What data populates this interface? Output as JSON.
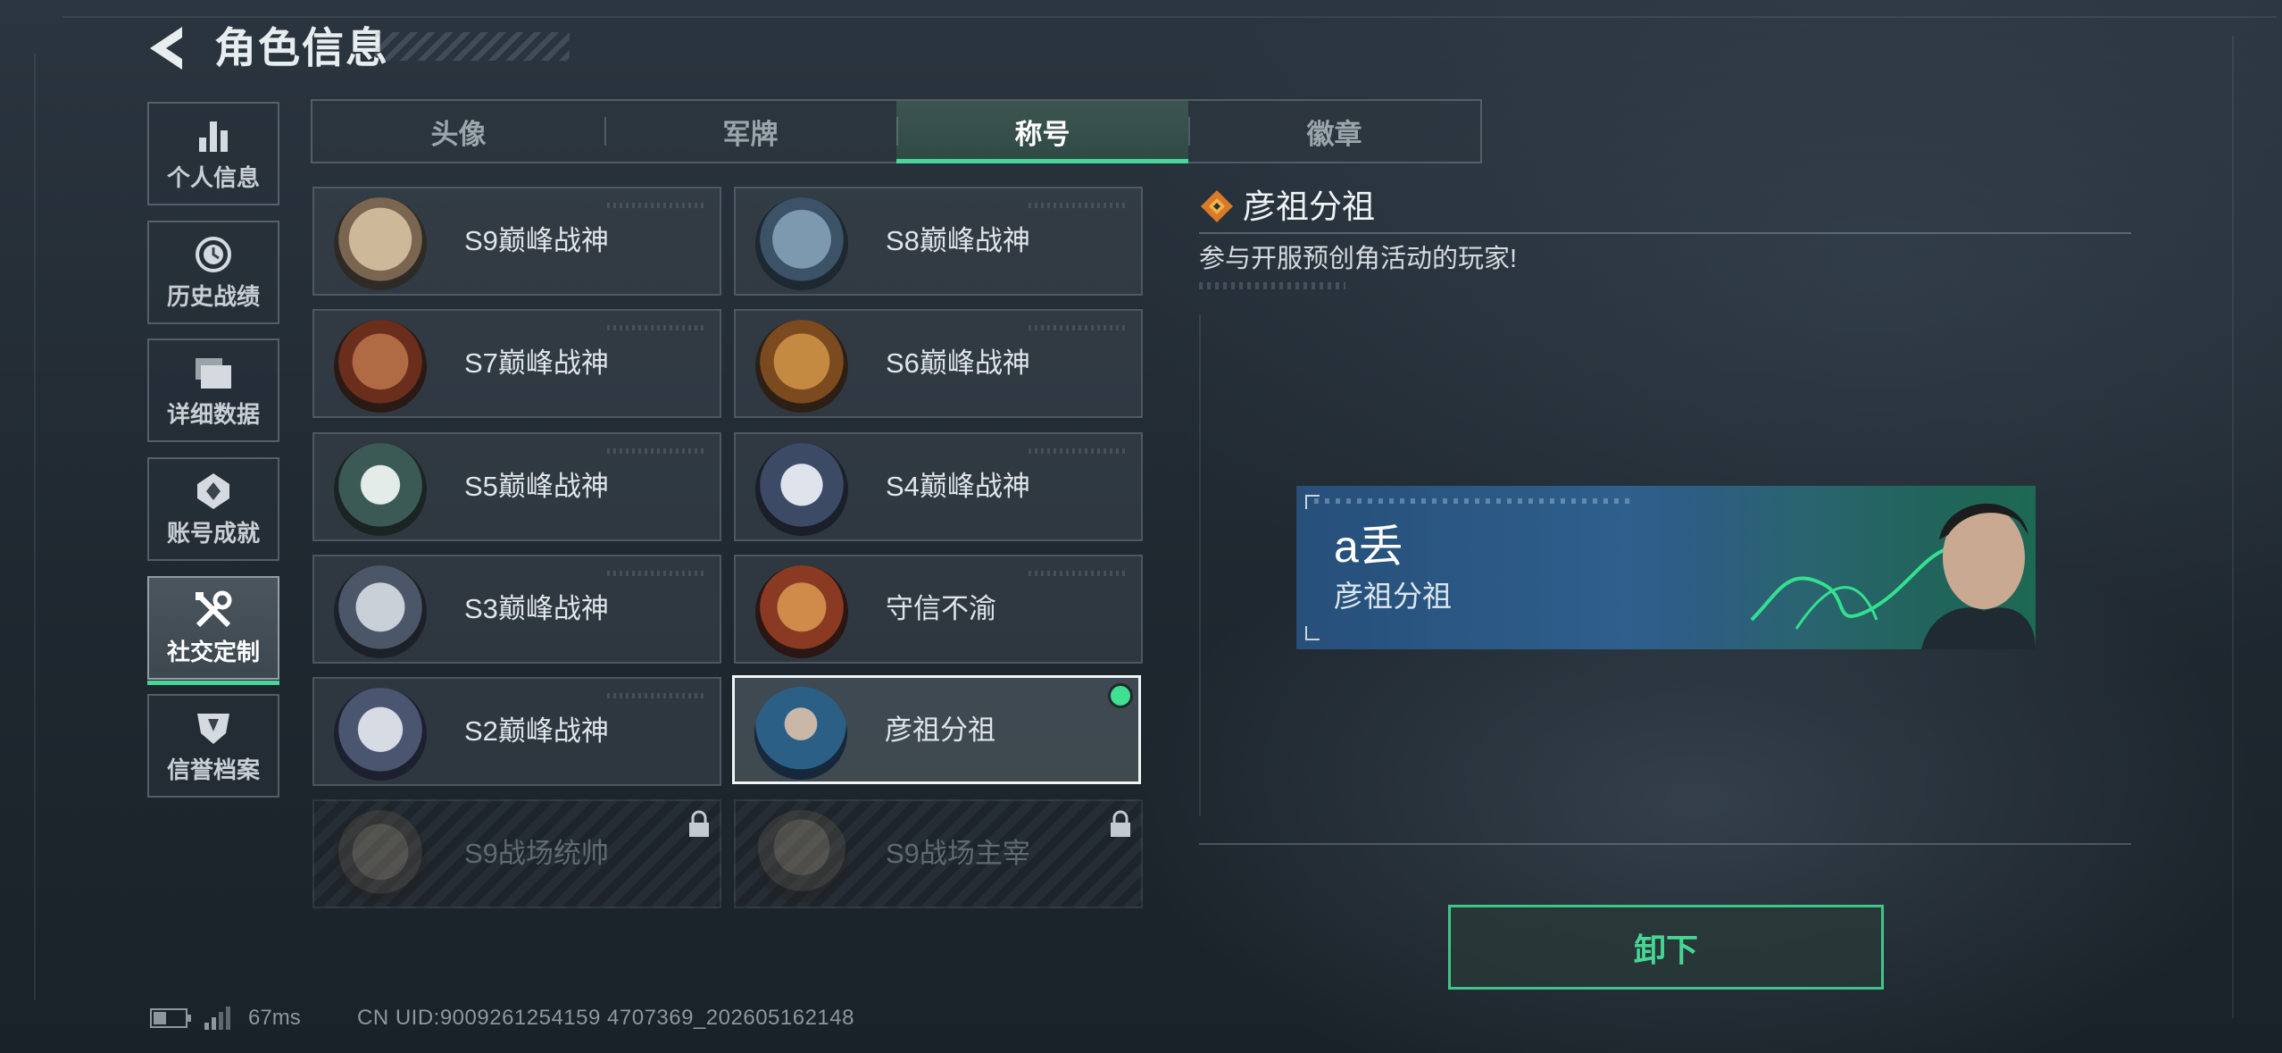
{
  "header": {
    "title": "角色信息"
  },
  "sidebar": {
    "items": [
      {
        "label": "个人信息",
        "icon": "bar-chart-icon",
        "active": false
      },
      {
        "label": "历史战绩",
        "icon": "clock-icon",
        "active": false
      },
      {
        "label": "详细数据",
        "icon": "folder-icon",
        "active": false
      },
      {
        "label": "账号成就",
        "icon": "achievement-icon",
        "active": false
      },
      {
        "label": "社交定制",
        "icon": "tools-icon",
        "active": true
      },
      {
        "label": "信誉档案",
        "icon": "shield-icon",
        "active": false
      }
    ]
  },
  "tabs": [
    {
      "label": "头像",
      "active": false
    },
    {
      "label": "军牌",
      "active": false
    },
    {
      "label": "称号",
      "active": true
    },
    {
      "label": "徽章",
      "active": false
    }
  ],
  "titles": [
    {
      "label": "S9巅峰战神",
      "emblem": "fortress-emblem-icon",
      "color": "#a58b6e",
      "state": "normal"
    },
    {
      "label": "S8巅峰战神",
      "emblem": "stripe-emblem-icon",
      "color": "#5b7388",
      "state": "normal"
    },
    {
      "label": "S7巅峰战神",
      "emblem": "rifle-emblem-icon",
      "color": "#7a3a24",
      "state": "normal"
    },
    {
      "label": "S6巅峰战神",
      "emblem": "t-emblem-icon",
      "color": "#8a5a28",
      "state": "normal"
    },
    {
      "label": "S5巅峰战神",
      "emblem": "skull-mask-emblem-icon",
      "color": "#3b5a56",
      "state": "normal"
    },
    {
      "label": "S4巅峰战神",
      "emblem": "helmet-emblem-icon",
      "color": "#3c4a66",
      "state": "normal"
    },
    {
      "label": "S3巅峰战神",
      "emblem": "globe-emblem-icon",
      "color": "#4b5768",
      "state": "normal"
    },
    {
      "label": "守信不渝",
      "emblem": "scales-emblem-icon",
      "color": "#8a3a22",
      "state": "normal"
    },
    {
      "label": "S2巅峰战神",
      "emblem": "triangle-emblem-icon",
      "color": "#4a5570",
      "state": "normal"
    },
    {
      "label": "彦祖分祖",
      "emblem": "portrait-emblem-icon",
      "color": "#2c5f86",
      "state": "selected"
    },
    {
      "label": "S9战场统帅",
      "emblem": "warship-emblem-icon",
      "color": "#5c554a",
      "state": "locked"
    },
    {
      "label": "S9战场主宰",
      "emblem": "mushroom-cloud-emblem-icon",
      "color": "#5c554a",
      "state": "locked"
    }
  ],
  "detail": {
    "icon": "diamond-icon",
    "name": "彦祖分祖",
    "description": "参与开服预创角活动的玩家!",
    "banner": {
      "player_name": "a丢",
      "title": "彦祖分祖"
    }
  },
  "actions": {
    "unequip_label": "卸下"
  },
  "status": {
    "ping": "67ms",
    "uid": "CN UID:9009261254159 4707369_202605162148"
  },
  "colors": {
    "accent": "#49d69a",
    "banner": "#2e5f8d"
  }
}
